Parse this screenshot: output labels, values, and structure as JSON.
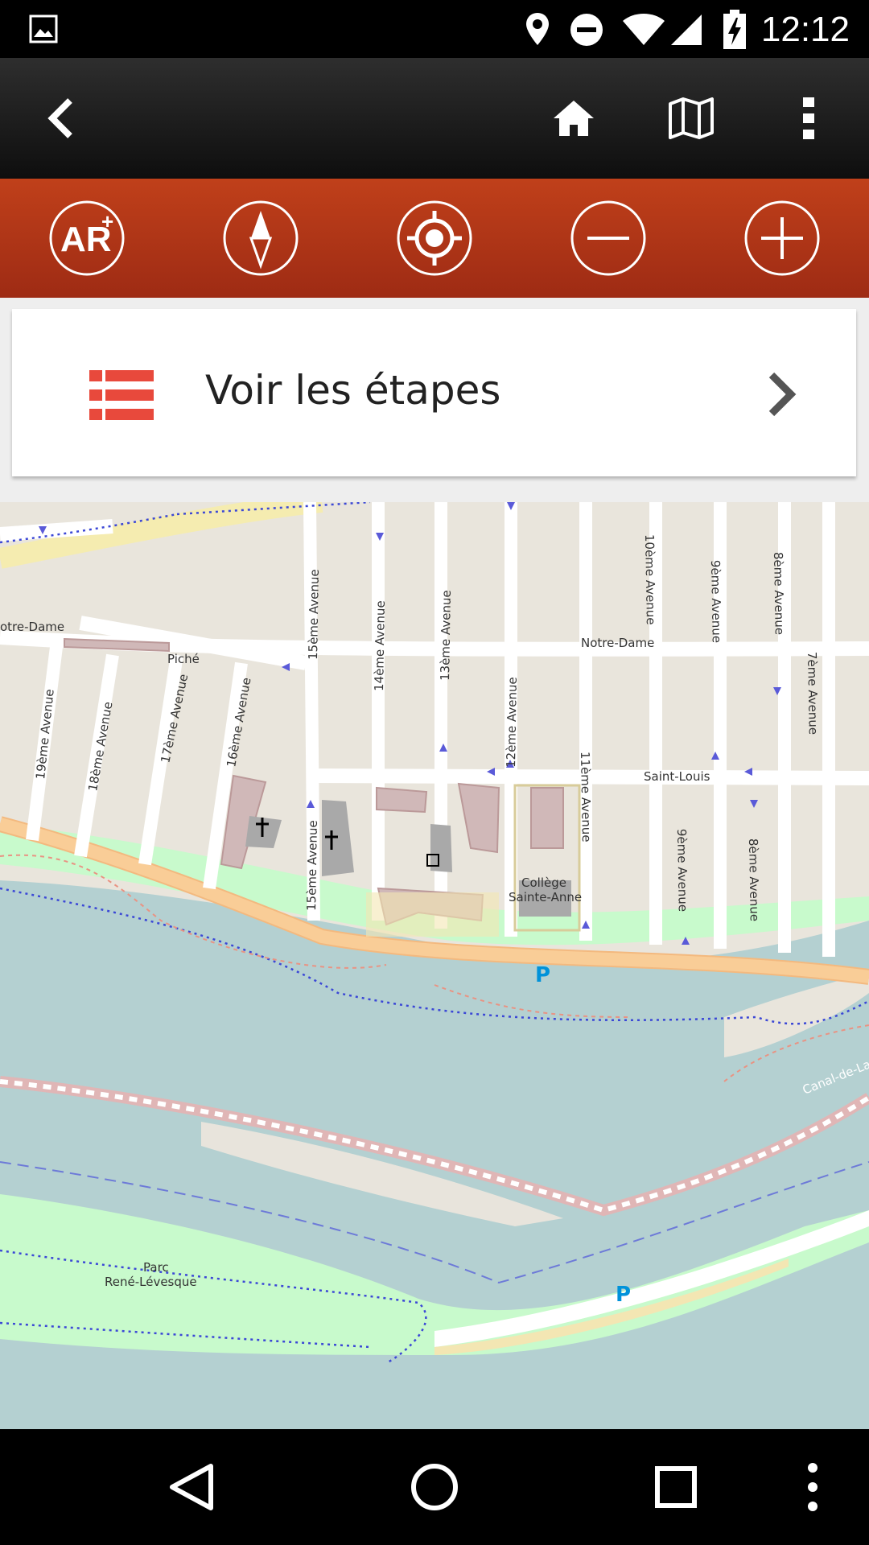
{
  "status_bar": {
    "time": "12:12",
    "icons": [
      "image-notification-icon",
      "location-icon",
      "do-not-disturb-icon",
      "wifi-icon",
      "cell-signal-icon",
      "battery-charging-icon"
    ]
  },
  "app_bar": {
    "buttons": [
      "back-icon",
      "home-icon",
      "map-icon",
      "overflow-menu-icon"
    ]
  },
  "map_toolbar": {
    "ar_label": "AR",
    "buttons": [
      "ar-plus-button",
      "compass-button",
      "locate-button",
      "zoom-out-button",
      "zoom-in-button"
    ]
  },
  "steps_card": {
    "label": "Voir les étapes"
  },
  "map": {
    "labels": {
      "notre_dame_left": "otre-Dame",
      "notre_dame_right": "Notre-Dame",
      "piche": "Piché",
      "saint_louis": "Saint-Louis",
      "av19": "19ème Avenue",
      "av18": "18ème Avenue",
      "av17": "17ème Avenue",
      "av16": "16ème Avenue",
      "av15_top": "15ème Avenue",
      "av15_bottom": "15ème Avenue",
      "av14": "14ème Avenue",
      "av13": "13ème Avenue",
      "av12": "12ème Avenue",
      "av11": "11ème Avenue",
      "av10": "10ème Avenue",
      "av9_top": "9ème Avenue",
      "av9_bottom": "9ème Avenue",
      "av8_top": "8ème Avenue",
      "av8_bottom": "8ème Avenue",
      "av7": "7ème Avenue",
      "college_line1": "Collège",
      "college_line2": "Sainte-Anne",
      "parc_line1": "Parc",
      "parc_line2": "René-Lévesque",
      "canal": "Canal-de-La",
      "parking": "P"
    }
  },
  "nav_bar": {
    "buttons": [
      "back-nav-icon",
      "home-nav-icon",
      "recents-nav-icon",
      "overflow-nav-icon"
    ]
  },
  "colors": {
    "toolbar": "#b0341a",
    "list_icon": "#e8493c",
    "water": "#b4d0d1",
    "park": "#c8facc",
    "main_road": "#f9cd97"
  }
}
